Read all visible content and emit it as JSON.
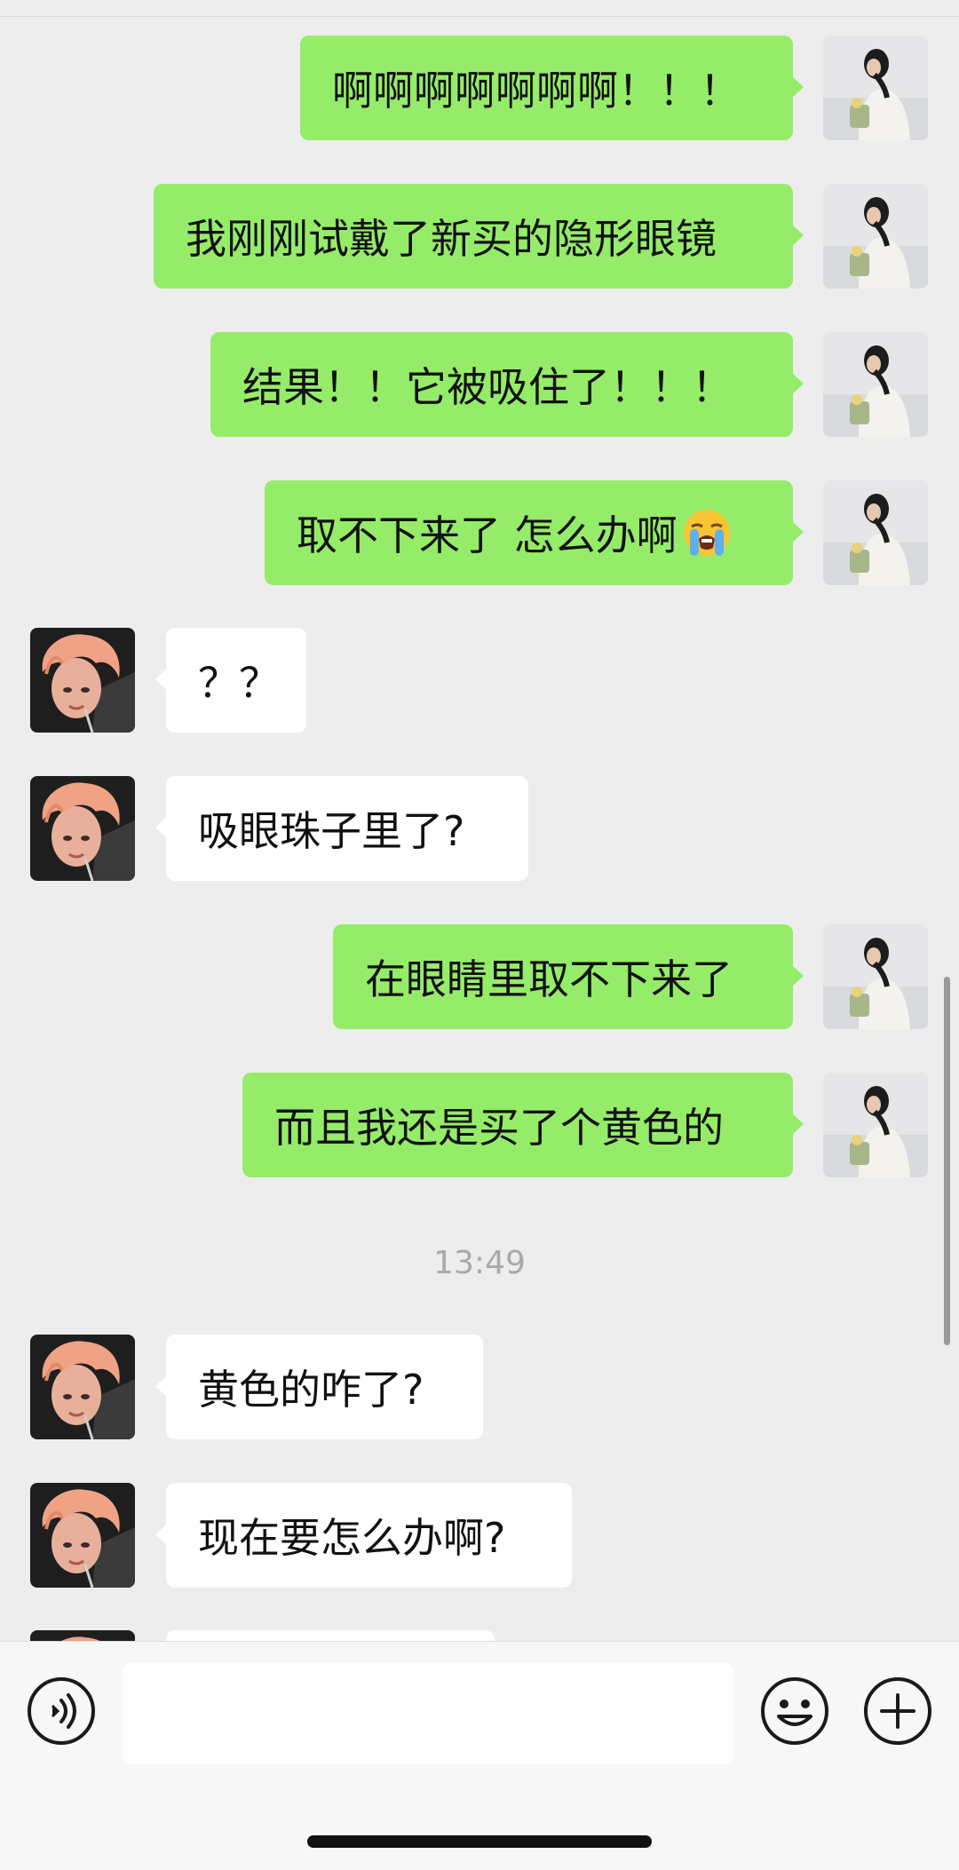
{
  "messages": [
    {
      "sender": "me",
      "text": "啊啊啊啊啊啊啊！！！"
    },
    {
      "sender": "me",
      "text": "我刚刚试戴了新买的隐形眼镜"
    },
    {
      "sender": "me",
      "text": "结果！！它被吸住了！！！"
    },
    {
      "sender": "me",
      "text": "取不下来了 怎么办啊",
      "emoji": "loudly-crying-face-emoji"
    },
    {
      "sender": "them",
      "text": "？？"
    },
    {
      "sender": "them",
      "text": "吸眼珠子里了?"
    },
    {
      "sender": "me",
      "text": "在眼睛里取不下来了"
    },
    {
      "sender": "me",
      "text": "而且我还是买了个黄色的"
    },
    {
      "sender": "them",
      "text": "黄色的咋了?"
    },
    {
      "sender": "them",
      "text": "现在要怎么办啊?"
    }
  ],
  "timestamp": "13:49",
  "input_bar": {
    "voice_icon": "voice-icon",
    "emoji_icon": "smiley-face-icon",
    "plus_icon": "plus-icon",
    "text_value": ""
  },
  "colors": {
    "my_bubble": "#95ec69",
    "their_bubble": "#ffffff",
    "background": "#ededed"
  }
}
